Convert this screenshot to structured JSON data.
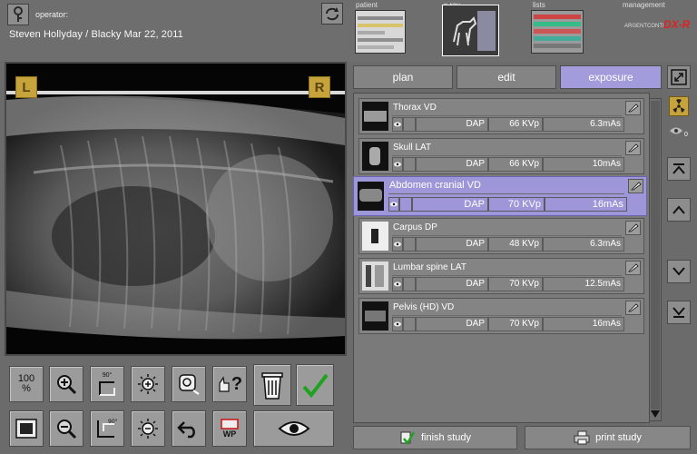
{
  "header": {
    "operator_label": "operator:",
    "patient_line": "Steven Hollyday / Blacky  Mar 22, 2011"
  },
  "nav": {
    "patient": "patient",
    "xray": "x-ray",
    "lists": "lists",
    "management": "management",
    "brand": "DX-R",
    "brand_prefix": "ARGENTCONTI"
  },
  "viewer": {
    "left_marker": "L",
    "right_marker": "R"
  },
  "tabs": [
    {
      "label": "plan"
    },
    {
      "label": "edit"
    },
    {
      "label": "exposure"
    }
  ],
  "exposures": [
    {
      "name": "Thorax VD",
      "dap": "DAP",
      "kvp": "66 KVp",
      "mas": "6.3mAs"
    },
    {
      "name": "Skull LAT",
      "dap": "DAP",
      "kvp": "66 KVp",
      "mas": "10mAs"
    },
    {
      "name": "Abdomen cranial VD",
      "dap": "DAP",
      "kvp": "70 KVp",
      "mas": "16mAs"
    },
    {
      "name": "Carpus DP",
      "dap": "DAP",
      "kvp": "48 KVp",
      "mas": "6.3mAs"
    },
    {
      "name": "Lumbar spine LAT",
      "dap": "DAP",
      "kvp": "70 KVp",
      "mas": "12.5mAs"
    },
    {
      "name": "Pelvis (HD) VD",
      "dap": "DAP",
      "kvp": "70 KVp",
      "mas": "16mAs"
    }
  ],
  "toolbar": {
    "zoom_100": "100",
    "zoom_100_unit": "%",
    "wp_label": "WP",
    "help_label": "?",
    "rotate_90": "90°"
  },
  "side": {
    "eye_badge": "0"
  },
  "bottom": {
    "finish": "finish study",
    "print": "print study"
  },
  "colors": {
    "accent": "#a29bdc",
    "selected_row": "#9d96d8",
    "panel": "#6b6b6b"
  }
}
